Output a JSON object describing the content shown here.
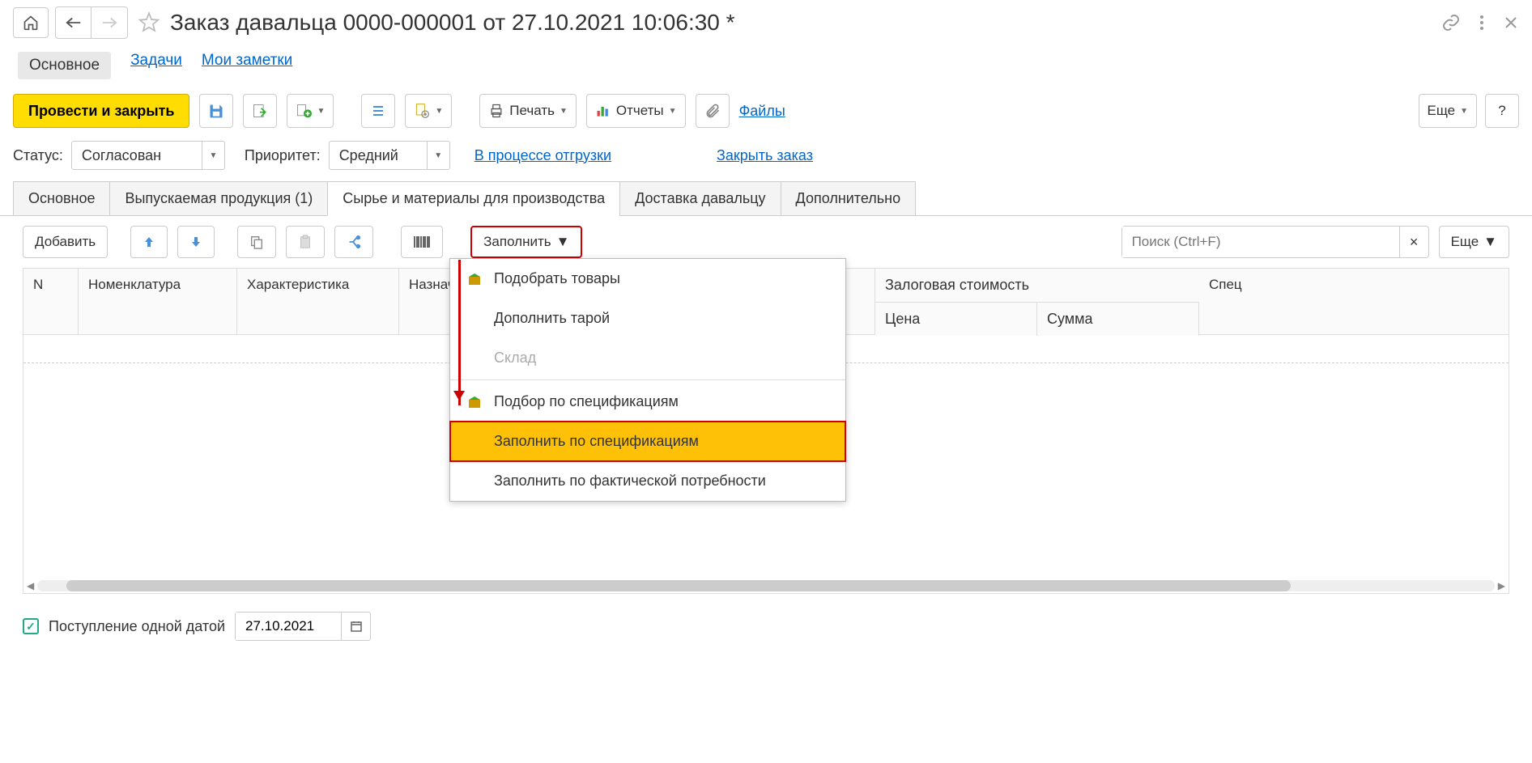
{
  "header": {
    "title": "Заказ давальца 0000-000001 от 27.10.2021 10:06:30 *"
  },
  "navtabs": {
    "main": "Основное",
    "tasks": "Задачи",
    "notes": "Мои заметки"
  },
  "toolbar": {
    "post_close": "Провести и закрыть",
    "print": "Печать",
    "reports": "Отчеты",
    "files": "Файлы",
    "more": "Еще",
    "help": "?"
  },
  "status": {
    "status_label": "Статус:",
    "status_value": "Согласован",
    "priority_label": "Приоритет:",
    "priority_value": "Средний",
    "shipping_link": "В процессе отгрузки",
    "close_link": "Закрыть заказ"
  },
  "doctabs": {
    "t1": "Основное",
    "t2": "Выпускаемая продукция (1)",
    "t3": "Сырье и материалы для производства",
    "t4": "Доставка давальцу",
    "t5": "Дополнительно"
  },
  "subtoolbar": {
    "add": "Добавить",
    "fill": "Заполнить",
    "search_placeholder": "Поиск (Ctrl+F)",
    "more": "Еще"
  },
  "fill_menu": {
    "pick_goods": "Подобрать товары",
    "add_tare": "Дополнить тарой",
    "warehouse": "Склад",
    "pick_by_spec": "Подбор по спецификациям",
    "fill_by_spec": "Заполнить по спецификациям",
    "fill_by_actual": "Заполнить по фактической потребности"
  },
  "grid": {
    "col_n": "N",
    "col_nomen": "Номенклатура",
    "col_char": "Характеристика",
    "col_purpose": "Назначе",
    "col_collateral": "Залоговая стоимость",
    "col_price": "Цена",
    "col_sum": "Сумма",
    "col_spec": "Спец"
  },
  "footer": {
    "single_date": "Поступление одной датой",
    "date_value": "27.10.2021"
  }
}
